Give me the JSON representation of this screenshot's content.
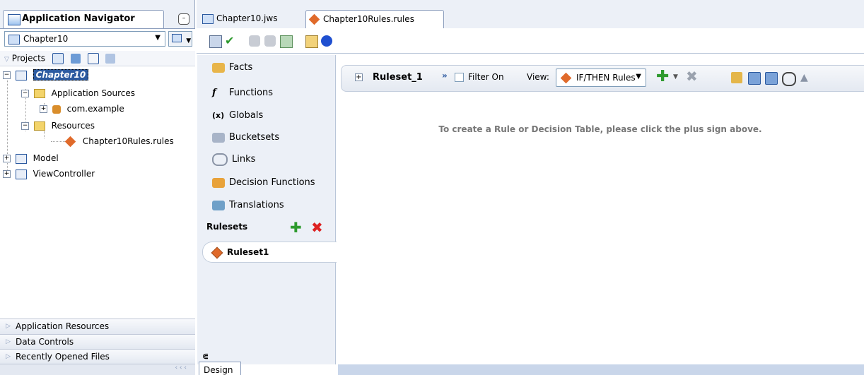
{
  "navigator": {
    "title": "Application Navigator",
    "minimize_glyph": "–",
    "project": "Chapter10",
    "dropdown_glyph": "▼",
    "projects_label": "Projects",
    "tree": {
      "root": "Chapter10",
      "app_sources": "Application Sources",
      "package": "com.example",
      "resources": "Resources",
      "rules_file": "Chapter10Rules.rules",
      "model": "Model",
      "view_controller": "ViewController"
    },
    "accordions": [
      "Application Resources",
      "Data Controls",
      "Recently Opened Files"
    ],
    "footer_glyph": "‹ ‹ ‹"
  },
  "editor": {
    "tabs": [
      "Chapter10.jws",
      "Chapter10Rules.rules"
    ],
    "bottom_tab": "Design"
  },
  "side_panel": {
    "items": [
      "Facts",
      "Functions",
      "Globals",
      "Bucketsets",
      "Links",
      "Decision Functions",
      "Translations"
    ],
    "rulesets_header": "Rulesets",
    "ruleset_item": "Ruleset1",
    "collapse_glyph": "⋐"
  },
  "ruleset": {
    "name": "Ruleset_1",
    "filter_label": "Filter On",
    "view_label": "View:",
    "view_value": "IF/THEN Rules",
    "empty_message": "To create a Rule or Decision Table, please click the plus sign above."
  },
  "colors": {
    "selection": "#2c5aa0",
    "add": "#2e9a2e",
    "delete": "#d22222",
    "rule_diamond": "#e06a2a"
  }
}
